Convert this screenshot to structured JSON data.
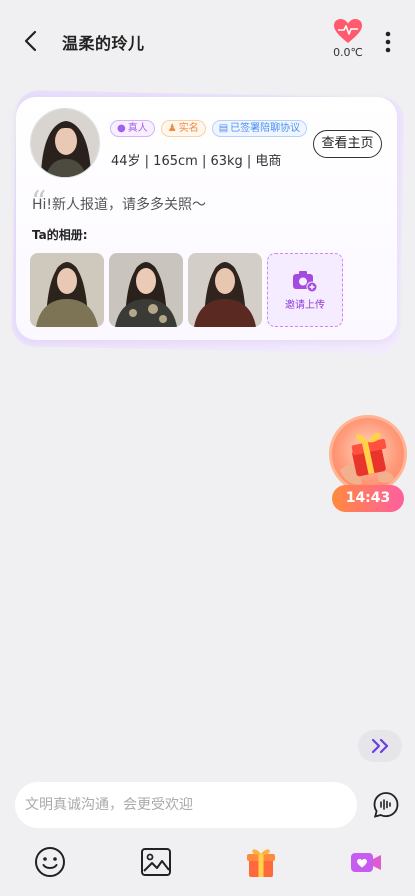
{
  "header": {
    "title": "温柔的玲儿",
    "heat_value": "0.0℃"
  },
  "profile": {
    "badges": {
      "real": "真人",
      "name": "实名",
      "agreement": "已签署陪聊协议"
    },
    "info_line": "44岁 | 165cm | 63kg | 电商",
    "view_home_label": "查看主页",
    "greeting": "Hi!新人报道，请多多关照～",
    "album_label": "Ta的相册:",
    "upload_label": "邀请上传"
  },
  "gift_timer": {
    "time": "14:43"
  },
  "input": {
    "placeholder": "文明真诚沟通，会更受欢迎"
  },
  "colors": {
    "accent": "#a45ff0",
    "timer_start": "#ff8a3d",
    "timer_end": "#ff5fa0"
  },
  "icons": {
    "back": "back-arrow-icon",
    "heat": "heart-pulse-icon",
    "more": "more-vertical-icon",
    "emoji": "emoji-icon",
    "image": "image-icon",
    "gift": "gift-icon",
    "video": "video-call-icon",
    "voice": "voice-icon",
    "scroll": "double-chevron-right-icon"
  }
}
